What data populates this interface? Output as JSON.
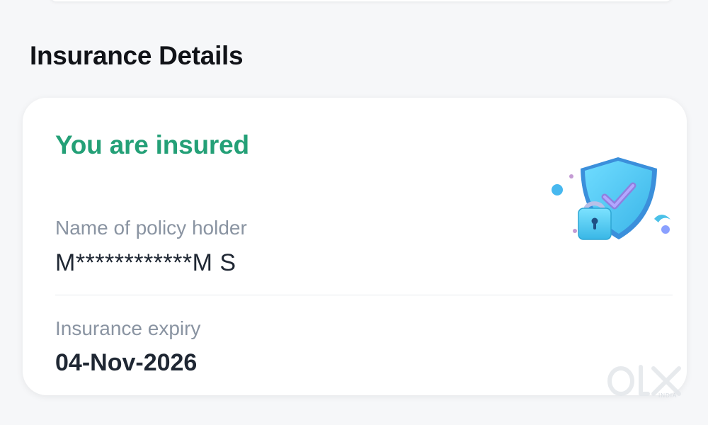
{
  "section": {
    "title": "Insurance Details"
  },
  "card": {
    "status": "You are insured",
    "policy_holder_label": "Name of policy holder",
    "policy_holder_value": "M************M S",
    "expiry_label": "Insurance expiry",
    "expiry_value": "04-Nov-2026"
  },
  "icons": {
    "illustration": "insurance-shield-lock-icon",
    "watermark": "olx-logo"
  },
  "colors": {
    "status_green": "#24a077",
    "label_gray": "#8a94a2",
    "value_dark": "#1f2733",
    "shield_blue": "#58c8f2"
  },
  "watermark": {
    "brand": "OLX",
    "subtext": "INDIA"
  }
}
